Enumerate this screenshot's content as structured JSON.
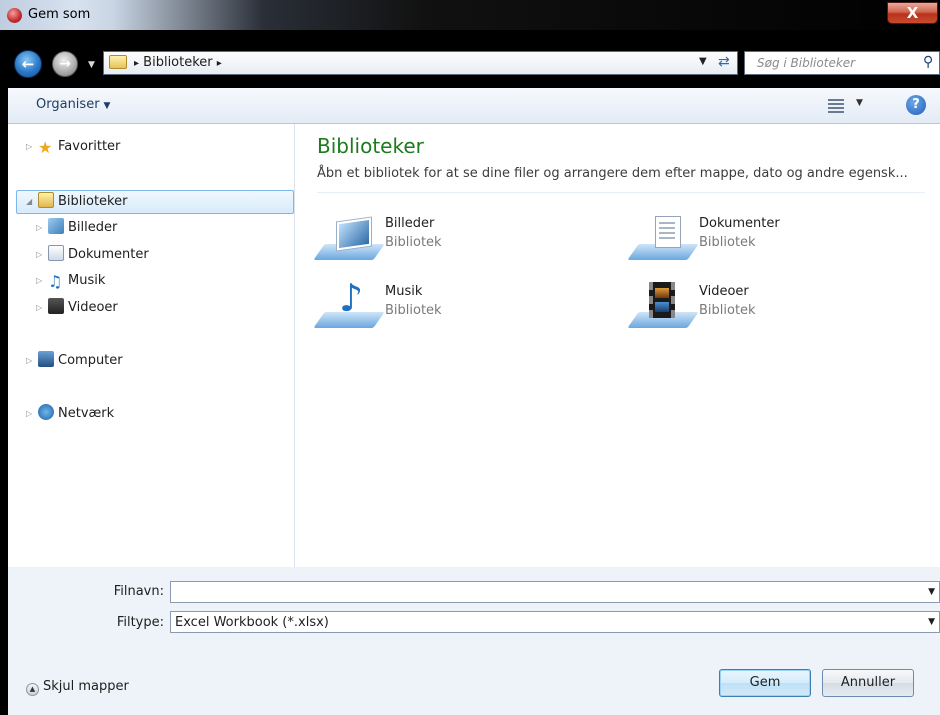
{
  "window": {
    "title": "Gem som",
    "close_glyph": "X"
  },
  "address": {
    "crumb": "Biblioteker",
    "arrow": "▸"
  },
  "search": {
    "placeholder": "Søg i Biblioteker"
  },
  "toolbar": {
    "organise": "Organiser"
  },
  "sidebar": {
    "favorites": "Favoritter",
    "libraries": "Biblioteker",
    "pictures": "Billeder",
    "documents": "Dokumenter",
    "music": "Musik",
    "videos": "Videoer",
    "computer": "Computer",
    "network": "Netværk"
  },
  "content": {
    "title": "Biblioteker",
    "subtitle": "Åbn et bibliotek for at se dine filer og arrangere dem efter mappe, dato og andre egensk...",
    "libraries": [
      {
        "name": "Billeder",
        "type": "Bibliotek"
      },
      {
        "name": "Dokumenter",
        "type": "Bibliotek"
      },
      {
        "name": "Musik",
        "type": "Bibliotek"
      },
      {
        "name": "Videoer",
        "type": "Bibliotek"
      }
    ]
  },
  "form": {
    "filename_label": "Filnavn:",
    "filename_value": "",
    "filetype_label": "Filtype:",
    "filetype_value": "Excel Workbook (*.xlsx)"
  },
  "footer": {
    "toggle_folders": "Skjul mapper",
    "save": "Gem",
    "cancel": "Annuller"
  }
}
